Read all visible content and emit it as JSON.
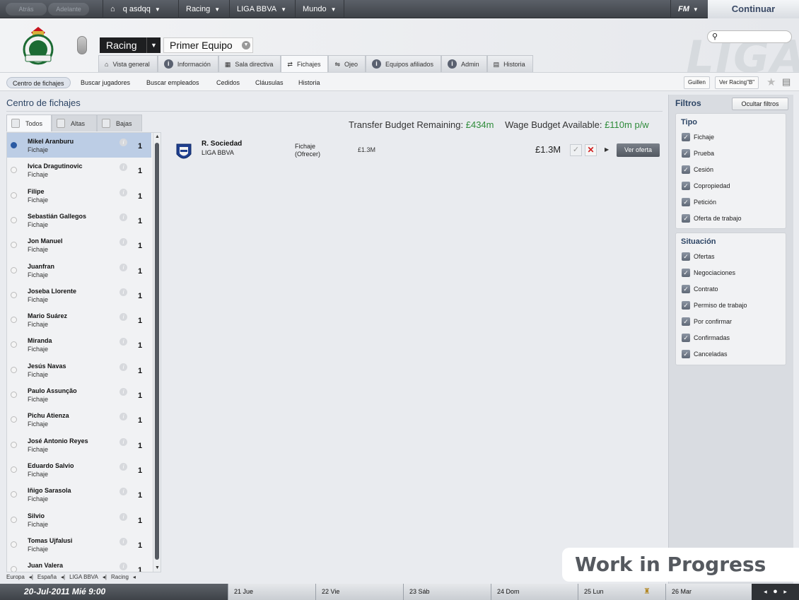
{
  "topnav": {
    "back": "Atrás",
    "forward": "Adelante",
    "manager": "q asdqq",
    "club": "Racing",
    "league": "LIGA BBVA",
    "world": "Mundo",
    "fm": "FM",
    "continue": "Continuar"
  },
  "header": {
    "club_selector": "Racing",
    "team_selector": "Primer Equipo",
    "bg_text": "LIGA",
    "tabs": [
      "Vista general",
      "Información",
      "Sala directiva",
      "Fichajes",
      "Ojeo",
      "Equipos afiliados",
      "Admin",
      "Historia"
    ]
  },
  "subnav": {
    "items": [
      "Centro de fichajes",
      "Buscar jugadores",
      "Buscar empleados",
      "Cedidos",
      "Cláusulas",
      "Historia"
    ],
    "right_buttons": [
      "Guillen",
      "Ver Racing\"B\""
    ]
  },
  "page": {
    "title": "Centro de fichajes",
    "filter_tabs": [
      "Todos",
      "Altas",
      "Bajas"
    ]
  },
  "players": [
    {
      "name": "Mikel Aranburu",
      "type": "Fichaje",
      "count": "1"
    },
    {
      "name": "Ivica Dragutinovic",
      "type": "Fichaje",
      "count": "1"
    },
    {
      "name": "Filipe",
      "type": "Fichaje",
      "count": "1"
    },
    {
      "name": "Sebastián Gallegos",
      "type": "Fichaje",
      "count": "1"
    },
    {
      "name": "Jon Manuel",
      "type": "Fichaje",
      "count": "1"
    },
    {
      "name": "Juanfran",
      "type": "Fichaje",
      "count": "1"
    },
    {
      "name": "Joseba Llorente",
      "type": "Fichaje",
      "count": "1"
    },
    {
      "name": "Mario Suárez",
      "type": "Fichaje",
      "count": "1"
    },
    {
      "name": "Miranda",
      "type": "Fichaje",
      "count": "1"
    },
    {
      "name": "Jesús Navas",
      "type": "Fichaje",
      "count": "1"
    },
    {
      "name": "Paulo Assunção",
      "type": "Fichaje",
      "count": "1"
    },
    {
      "name": "Pichu Atienza",
      "type": "Fichaje",
      "count": "1"
    },
    {
      "name": "José Antonio Reyes",
      "type": "Fichaje",
      "count": "1"
    },
    {
      "name": "Eduardo Salvio",
      "type": "Fichaje",
      "count": "1"
    },
    {
      "name": "Iñigo Sarasola",
      "type": "Fichaje",
      "count": "1"
    },
    {
      "name": "Silvio",
      "type": "Fichaje",
      "count": "1"
    },
    {
      "name": "Tomas Ujfalusi",
      "type": "Fichaje",
      "count": "1"
    },
    {
      "name": "Juan Valera",
      "type": "",
      "count": "1"
    }
  ],
  "breadcrumb": [
    "Europa",
    "España",
    "LIGA BBVA",
    "Racing"
  ],
  "budget": {
    "transfer_label": "Transfer Budget Remaining:",
    "transfer_value": "£434m",
    "wage_label": "Wage Budget Available:",
    "wage_value": "£110m p/w"
  },
  "deal": {
    "club": "R. Sociedad",
    "league": "LIGA BBVA",
    "type_line1": "Fichaje",
    "type_line2": "(Ofrecer)",
    "fee": "£1.3M",
    "amount": "£1.3M",
    "view_offer": "Ver oferta"
  },
  "filters": {
    "title": "Filtros",
    "hide": "Ocultar filtros",
    "tipo_title": "Tipo",
    "tipo": [
      "Fichaje",
      "Prueba",
      "Cesión",
      "Copropiedad",
      "Petición",
      "Oferta de trabajo"
    ],
    "situacion_title": "Situación",
    "situacion": [
      "Ofertas",
      "Negociaciones",
      "Contrato",
      "Permiso de trabajo",
      "Por confirmar",
      "Confirmadas",
      "Canceladas"
    ]
  },
  "watermark": "Work in Progress",
  "bottombar": {
    "date": "20-Jul-2011 Mié 9:00",
    "days": [
      "21 Jue",
      "22 Vie",
      "23 Sáb",
      "24 Dom",
      "25 Lun",
      "26 Mar"
    ]
  },
  "colors": {
    "accent_blue": "#2d4565",
    "budget_green": "#2e8b3a",
    "reject_red": "#d12020"
  }
}
